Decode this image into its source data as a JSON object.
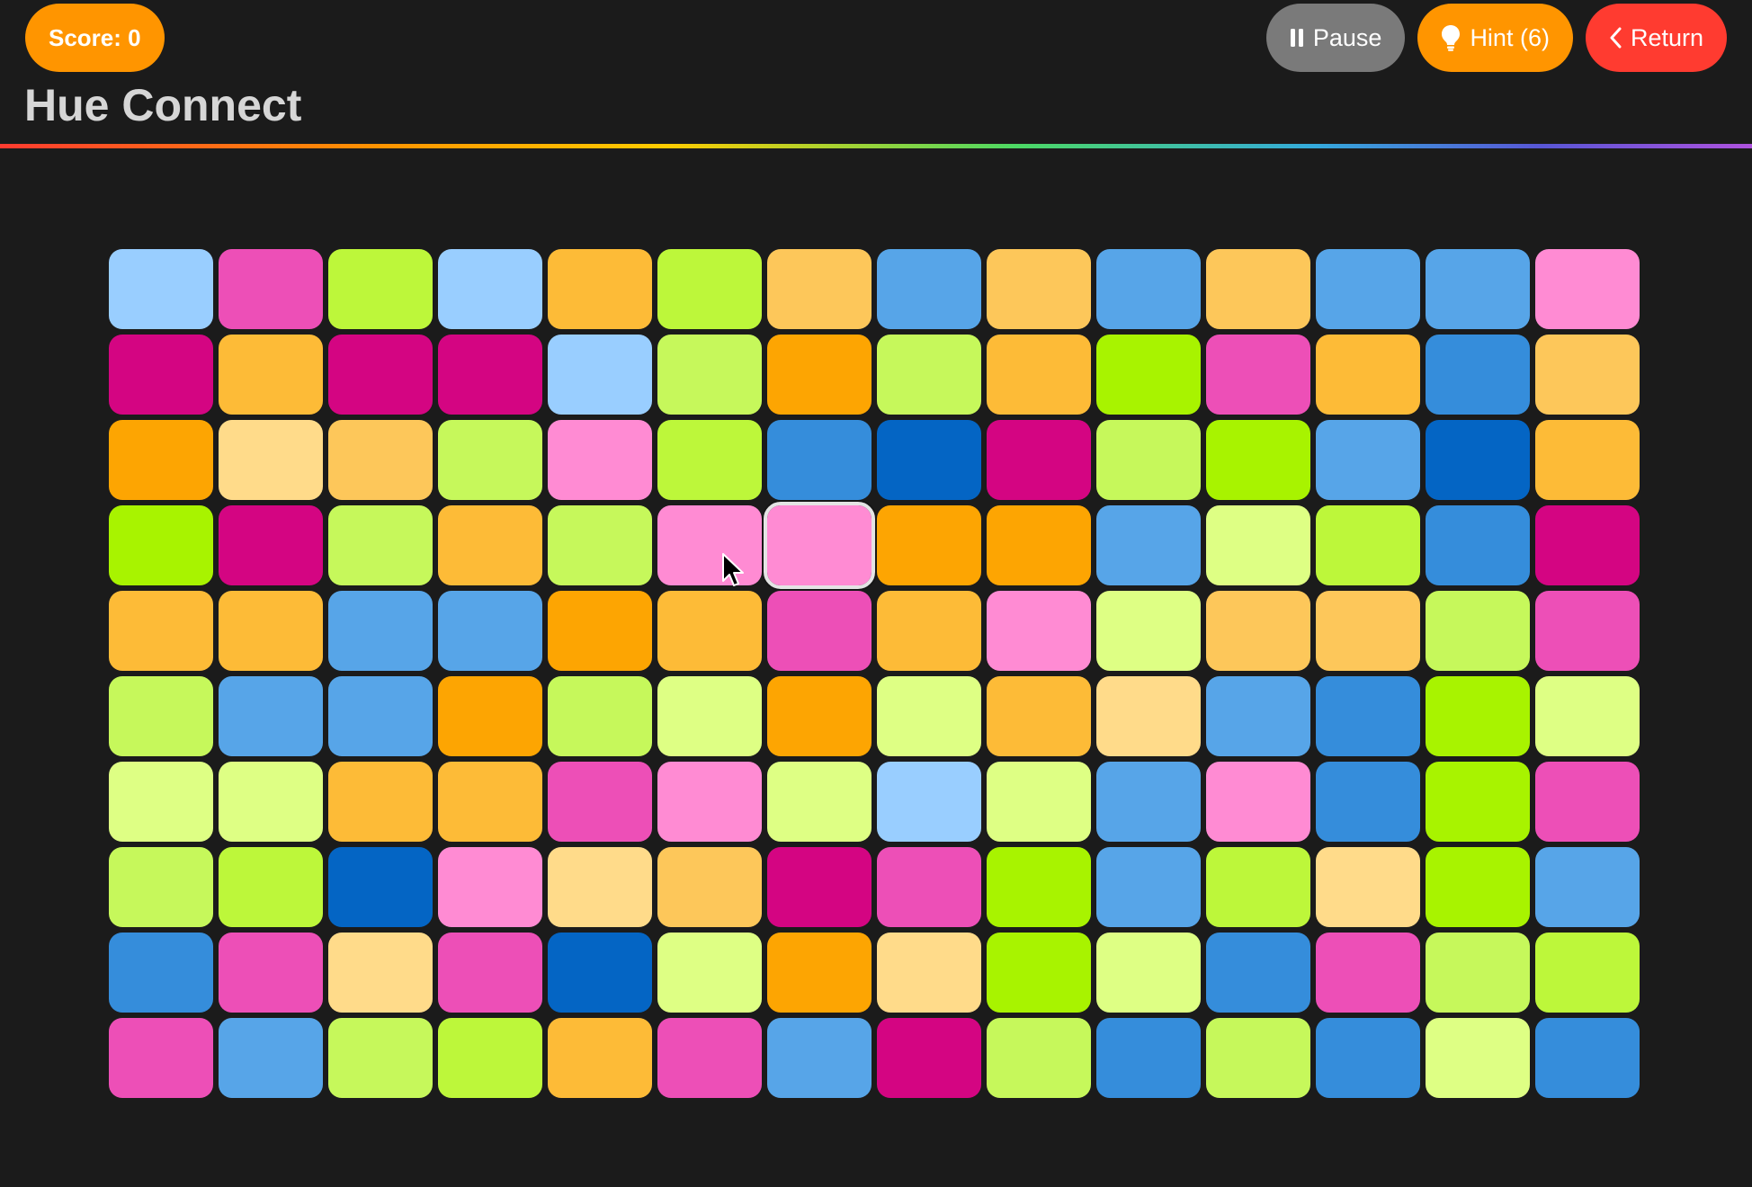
{
  "header": {
    "score_label": "Score: 0",
    "title": "Hue Connect"
  },
  "toolbar": {
    "pause_label": "Pause",
    "hint_label": "Hint (6)",
    "return_label": "Return"
  },
  "colors": {
    "lb": "#99ceff",
    "mp": "#ed4fb7",
    "ll": "#bdf73a",
    "lo": "#fdbb37",
    "ly": "#fdc75a",
    "mb": "#57a5e8",
    "pp": "#ff8bd3",
    "mg": "#d40582",
    "lg": "#c6f85b",
    "dg": "#a8f300",
    "do": "#fda502",
    "bb": "#358ddb",
    "db": "#0465c4",
    "cr": "#ffdb8a",
    "pl": "#deff84"
  },
  "board": {
    "rows": 10,
    "cols": 14,
    "selected": {
      "row": 3,
      "col": 6
    },
    "tiles": [
      [
        "lb",
        "mp",
        "ll",
        "lb",
        "lo",
        "ll",
        "ly",
        "mb",
        "ly",
        "mb",
        "ly",
        "mb",
        "mb",
        "pp"
      ],
      [
        "mg",
        "lo",
        "mg",
        "mg",
        "lb",
        "lg",
        "do",
        "lg",
        "lo",
        "dg",
        "mp",
        "lo",
        "bb",
        "ly"
      ],
      [
        "do",
        "cr",
        "ly",
        "lg",
        "pp",
        "ll",
        "bb",
        "db",
        "mg",
        "lg",
        "dg",
        "mb",
        "db",
        "lo"
      ],
      [
        "dg",
        "mg",
        "lg",
        "lo",
        "lg",
        "pp",
        "pp",
        "do",
        "do",
        "mb",
        "pl",
        "ll",
        "bb",
        "mg"
      ],
      [
        "lo",
        "lo",
        "mb",
        "mb",
        "do",
        "lo",
        "mp",
        "lo",
        "pp",
        "pl",
        "ly",
        "ly",
        "lg",
        "mp"
      ],
      [
        "lg",
        "mb",
        "mb",
        "do",
        "lg",
        "pl",
        "do",
        "pl",
        "lo",
        "cr",
        "mb",
        "bb",
        "dg",
        "pl"
      ],
      [
        "pl",
        "pl",
        "lo",
        "lo",
        "mp",
        "pp",
        "pl",
        "lb",
        "pl",
        "mb",
        "pp",
        "bb",
        "dg",
        "mp"
      ],
      [
        "lg",
        "ll",
        "db",
        "pp",
        "cr",
        "ly",
        "mg",
        "mp",
        "dg",
        "mb",
        "ll",
        "cr",
        "dg",
        "mb"
      ],
      [
        "bb",
        "mp",
        "cr",
        "mp",
        "db",
        "pl",
        "do",
        "cr",
        "dg",
        "pl",
        "bb",
        "mp",
        "lg",
        "ll"
      ],
      [
        "mp",
        "mb",
        "lg",
        "ll",
        "lo",
        "mp",
        "mb",
        "mg",
        "lg",
        "bb",
        "lg",
        "bb",
        "pl",
        "bb"
      ]
    ]
  }
}
